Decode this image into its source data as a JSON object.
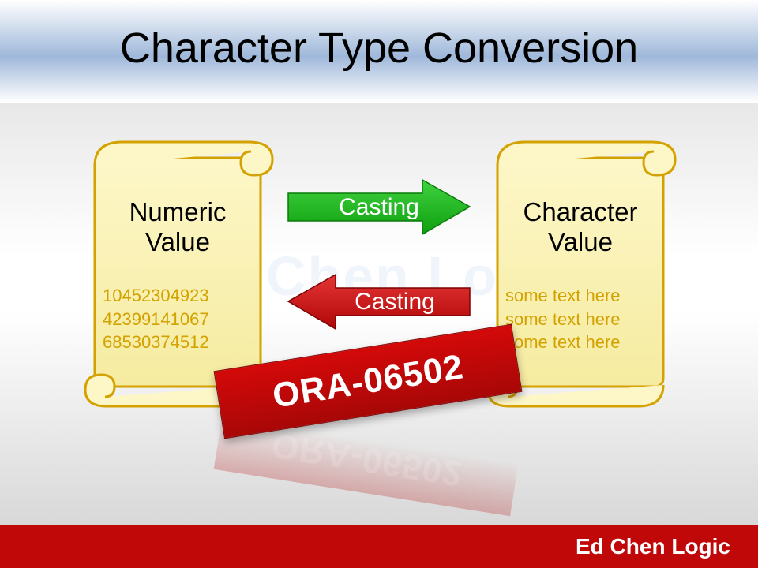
{
  "title": "Character Type Conversion",
  "watermark": "Ed Chen Logic",
  "left_scroll": {
    "heading_line1": "Numeric",
    "heading_line2": "Value",
    "lines": [
      "10452304923",
      "42399141067",
      "68530374512"
    ]
  },
  "right_scroll": {
    "heading_line1": "Character",
    "heading_line2": "Value",
    "lines": [
      "some text here",
      "some text here",
      "some text here"
    ]
  },
  "arrow_forward": "Casting",
  "arrow_back": "Casting",
  "error_code": "ORA-06502",
  "footer": "Ed Chen Logic"
}
